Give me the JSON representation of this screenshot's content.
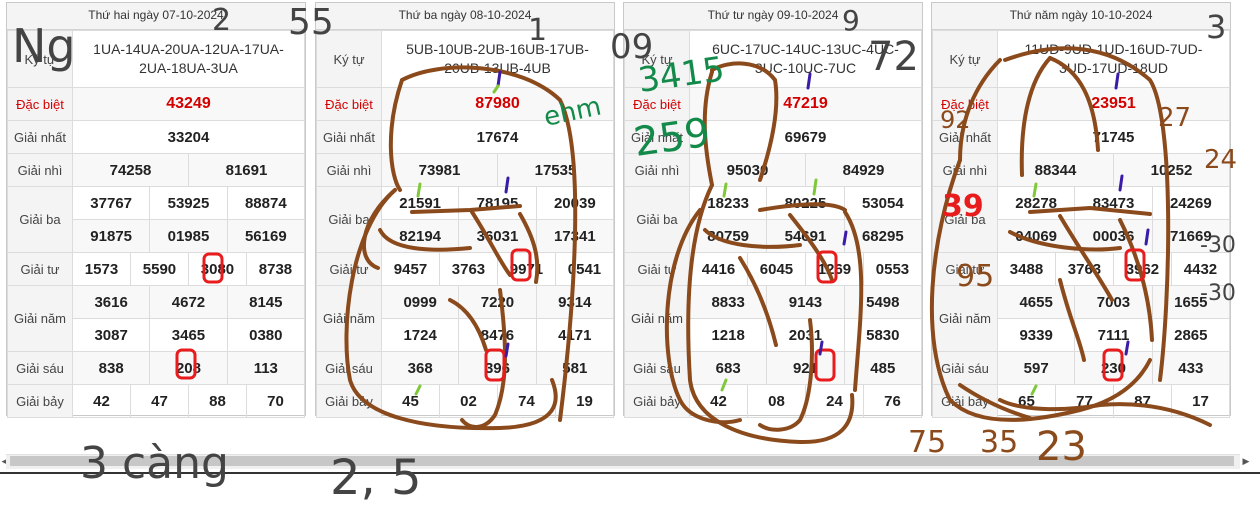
{
  "labels": {
    "ky_tu": "Ký tự",
    "dac_biet": "Đặc biệt",
    "giai_nhat": "Giải nhất",
    "giai_nhi": "Giải nhì",
    "giai_ba": "Giải ba",
    "giai_tu": "Giải tư",
    "giai_nam": "Giải năm",
    "giai_sau": "Giải sáu",
    "giai_bay": "Giải bảy"
  },
  "panels": [
    {
      "title": "Thứ hai ngày 07-10-2024",
      "code_line1": "1UA-14UA-20UA-12UA-17UA-",
      "code_line2": "2UA-18UA-3UA",
      "dac_biet": "43249",
      "giai_nhat": "33204",
      "giai_nhi": [
        "74258",
        "81691"
      ],
      "giai_ba": [
        "37767",
        "53925",
        "88874",
        "91875",
        "01985",
        "56169"
      ],
      "giai_tu": [
        "1573",
        "5590",
        "3080",
        "8738"
      ],
      "giai_nam": [
        "3616",
        "4672",
        "8145",
        "3087",
        "3465",
        "0380"
      ],
      "giai_sau": [
        "838",
        "208",
        "113"
      ],
      "giai_bay": [
        "42",
        "47",
        "88",
        "70"
      ]
    },
    {
      "title": "Thứ ba ngày 08-10-2024",
      "code_line1": "5UB-10UB-2UB-16UB-17UB-",
      "code_line2": "20UB-13UB-4UB",
      "dac_biet": "87980",
      "giai_nhat": "17674",
      "giai_nhi": [
        "73981",
        "17535"
      ],
      "giai_ba": [
        "21591",
        "78195",
        "20039",
        "82194",
        "36031",
        "17341"
      ],
      "giai_tu": [
        "9457",
        "3763",
        "9971",
        "0541"
      ],
      "giai_nam": [
        "0999",
        "7220",
        "9314",
        "1724",
        "8476",
        "4171"
      ],
      "giai_sau": [
        "368",
        "396",
        "581"
      ],
      "giai_bay": [
        "45",
        "02",
        "74",
        "19"
      ]
    },
    {
      "title": "Thứ tư ngày 09-10-2024",
      "code_line1": "6UC-17UC-14UC-13UC-4UC-",
      "code_line2": "3UC-10UC-7UC",
      "dac_biet": "47219",
      "giai_nhat": "69679",
      "giai_nhi": [
        "95030",
        "84929"
      ],
      "giai_ba": [
        "18233",
        "80225",
        "53054",
        "80759",
        "54691",
        "68295"
      ],
      "giai_tu": [
        "4416",
        "6045",
        "1269",
        "0553"
      ],
      "giai_nam": [
        "8833",
        "9143",
        "5498",
        "1218",
        "2031",
        "5830"
      ],
      "giai_sau": [
        "683",
        "921",
        "485"
      ],
      "giai_bay": [
        "42",
        "08",
        "24",
        "76"
      ]
    },
    {
      "title": "Thứ năm ngày 10-10-2024",
      "code_line1": "11UD-9UD-1UD-16UD-7UD-",
      "code_line2": "3UD-17UD-18UD",
      "dac_biet": "23951",
      "giai_nhat": "71745",
      "giai_nhi": [
        "88344",
        "10252"
      ],
      "giai_ba": [
        "28278",
        "83473",
        "24269",
        "04069",
        "00036",
        "71669"
      ],
      "giai_tu": [
        "3488",
        "3763",
        "3962",
        "4432"
      ],
      "giai_nam": [
        "4655",
        "7003",
        "1655",
        "9339",
        "7111",
        "2865"
      ],
      "giai_sau": [
        "597",
        "230",
        "433"
      ],
      "giai_bay": [
        "65",
        "77",
        "87",
        "17"
      ]
    }
  ],
  "scrollbar": {
    "left_arrow": "◀",
    "right_arrow": "▶"
  },
  "annotations": {
    "gray_top_1": "Ng",
    "gray_top_2": "2",
    "gray_top_3": "55",
    "gray_top_4": "1",
    "gray_top_5": "09",
    "gray_top_6": "9",
    "gray_top_7": "72",
    "gray_top_8": "3",
    "green_1": "3415",
    "green_2": "259",
    "green_3": "ehm",
    "brown_1": "92",
    "brown_2": "27",
    "brown_3": "24",
    "brown_4": "95",
    "brown_5": "75",
    "brown_6": "35",
    "brown_7": "23",
    "red_1": "39",
    "gray_right_1": "-30",
    "gray_right_2": "-30",
    "gray_bottom_1": "3 càng",
    "gray_bottom_2": "2, 5"
  },
  "colors": {
    "red": "#d40000",
    "ink_gray": "#444444",
    "ink_brown": "#8b4a1c",
    "ink_green": "#138a4a",
    "ink_red": "#e81c1c"
  }
}
